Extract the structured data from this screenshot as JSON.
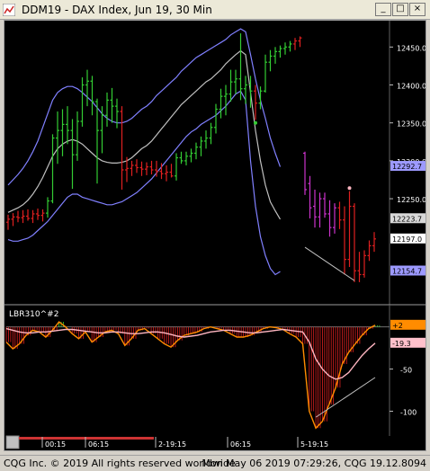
{
  "window": {
    "title": "DDM19 - DAX Index, Jun 19, 30 Min",
    "minimize_glyph": "_",
    "maximize_glyph": "□",
    "close_glyph": "×",
    "app_icon": "cqg-chart-icon"
  },
  "price_panel": {
    "axis_ticks": [
      "12450.0",
      "12400.0",
      "12350.0",
      "12300.0",
      "12250.0"
    ],
    "price_tags": [
      {
        "label": "12292.7",
        "color": "#9d9aff"
      },
      {
        "label": "12223.7",
        "color": "#d8d8d8"
      },
      {
        "label": "12197.0",
        "color": "#ffffff"
      },
      {
        "label": "12154.7",
        "color": "#9d9aff"
      }
    ]
  },
  "indicator_panel": {
    "label": "LBR310^#2",
    "axis_ticks": [
      "-50",
      "-100"
    ],
    "value_tags": [
      {
        "label": "+2",
        "color": "#ff8c00"
      },
      {
        "label": "-19.3",
        "color": "#ffc0cb"
      }
    ]
  },
  "time_axis": {
    "labels": [
      "00:15",
      "06:15",
      "2-19:15",
      "06:15",
      "5-19:15"
    ]
  },
  "status": {
    "left": "CQG Inc. © 2019 All rights reserved worldwide",
    "right": "Mon May 06 2019 07:29:26, CQG 19.12.8094"
  },
  "colors": {
    "background": "#000000",
    "bullish_bar": "#33cc33",
    "bearish_bar": "#e02020",
    "magenta_bar": "#cc33cc",
    "band": "#8080ff",
    "midline": "#c0c0c0",
    "oscillator": "#ff8c00",
    "signal": "#ffb6c1"
  },
  "chart_data": [
    {
      "type": "ohlc",
      "title": "",
      "ylabel": "",
      "ylim": [
        12115,
        12480
      ],
      "grid": false,
      "bars": [
        {
          "o": 12219,
          "h": 12229,
          "l": 12209,
          "c": 12223,
          "color": "red"
        },
        {
          "o": 12223,
          "h": 12231,
          "l": 12214,
          "c": 12226,
          "color": "red"
        },
        {
          "o": 12226,
          "h": 12234,
          "l": 12219,
          "c": 12225,
          "color": "red"
        },
        {
          "o": 12225,
          "h": 12235,
          "l": 12218,
          "c": 12227,
          "color": "red"
        },
        {
          "o": 12227,
          "h": 12236,
          "l": 12221,
          "c": 12224,
          "color": "red"
        },
        {
          "o": 12224,
          "h": 12235,
          "l": 12218,
          "c": 12230,
          "color": "red"
        },
        {
          "o": 12230,
          "h": 12237,
          "l": 12222,
          "c": 12228,
          "color": "red"
        },
        {
          "o": 12228,
          "h": 12236,
          "l": 12220,
          "c": 12231,
          "color": "red"
        },
        {
          "o": 12231,
          "h": 12252,
          "l": 12225,
          "c": 12247,
          "color": "green"
        },
        {
          "o": 12247,
          "h": 12335,
          "l": 12244,
          "c": 12330,
          "color": "green"
        },
        {
          "o": 12330,
          "h": 12365,
          "l": 12296,
          "c": 12340,
          "color": "green"
        },
        {
          "o": 12340,
          "h": 12368,
          "l": 12306,
          "c": 12348,
          "color": "green"
        },
        {
          "o": 12348,
          "h": 12372,
          "l": 12322,
          "c": 12340,
          "color": "green"
        },
        {
          "o": 12340,
          "h": 12355,
          "l": 12263,
          "c": 12308,
          "color": "green"
        },
        {
          "o": 12308,
          "h": 12365,
          "l": 12300,
          "c": 12352,
          "color": "green"
        },
        {
          "o": 12352,
          "h": 12410,
          "l": 12345,
          "c": 12400,
          "color": "green"
        },
        {
          "o": 12400,
          "h": 12420,
          "l": 12372,
          "c": 12405,
          "color": "green"
        },
        {
          "o": 12405,
          "h": 12412,
          "l": 12360,
          "c": 12378,
          "color": "green"
        },
        {
          "o": 12378,
          "h": 12382,
          "l": 12270,
          "c": 12340,
          "color": "green"
        },
        {
          "o": 12340,
          "h": 12372,
          "l": 12310,
          "c": 12360,
          "color": "green"
        },
        {
          "o": 12360,
          "h": 12390,
          "l": 12345,
          "c": 12380,
          "color": "green"
        },
        {
          "o": 12380,
          "h": 12396,
          "l": 12350,
          "c": 12372,
          "color": "green"
        },
        {
          "o": 12372,
          "h": 12382,
          "l": 12343,
          "c": 12365,
          "color": "green"
        },
        {
          "o": 12365,
          "h": 12372,
          "l": 12262,
          "c": 12288,
          "color": "red"
        },
        {
          "o": 12288,
          "h": 12305,
          "l": 12272,
          "c": 12290,
          "color": "red"
        },
        {
          "o": 12290,
          "h": 12300,
          "l": 12280,
          "c": 12294,
          "color": "red"
        },
        {
          "o": 12294,
          "h": 12302,
          "l": 12284,
          "c": 12291,
          "color": "red"
        },
        {
          "o": 12291,
          "h": 12299,
          "l": 12280,
          "c": 12289,
          "color": "red"
        },
        {
          "o": 12289,
          "h": 12298,
          "l": 12281,
          "c": 12292,
          "color": "red"
        },
        {
          "o": 12292,
          "h": 12300,
          "l": 12282,
          "c": 12288,
          "color": "red"
        },
        {
          "o": 12288,
          "h": 12300,
          "l": 12279,
          "c": 12286,
          "color": "red"
        },
        {
          "o": 12286,
          "h": 12297,
          "l": 12276,
          "c": 12283,
          "color": "red"
        },
        {
          "o": 12283,
          "h": 12294,
          "l": 12273,
          "c": 12285,
          "color": "red"
        },
        {
          "o": 12285,
          "h": 12296,
          "l": 12278,
          "c": 12280,
          "color": "red"
        },
        {
          "o": 12280,
          "h": 12310,
          "l": 12274,
          "c": 12304,
          "color": "green"
        },
        {
          "o": 12304,
          "h": 12312,
          "l": 12296,
          "c": 12300,
          "color": "green"
        },
        {
          "o": 12300,
          "h": 12312,
          "l": 12294,
          "c": 12306,
          "color": "green"
        },
        {
          "o": 12306,
          "h": 12316,
          "l": 12298,
          "c": 12310,
          "color": "green"
        },
        {
          "o": 12310,
          "h": 12324,
          "l": 12302,
          "c": 12318,
          "color": "green"
        },
        {
          "o": 12318,
          "h": 12332,
          "l": 12306,
          "c": 12326,
          "color": "green"
        },
        {
          "o": 12326,
          "h": 12340,
          "l": 12316,
          "c": 12330,
          "color": "green"
        },
        {
          "o": 12330,
          "h": 12350,
          "l": 12322,
          "c": 12344,
          "color": "green"
        },
        {
          "o": 12344,
          "h": 12375,
          "l": 12336,
          "c": 12368,
          "color": "green"
        },
        {
          "o": 12368,
          "h": 12395,
          "l": 12356,
          "c": 12385,
          "color": "green"
        },
        {
          "o": 12385,
          "h": 12400,
          "l": 12360,
          "c": 12388,
          "color": "green"
        },
        {
          "o": 12388,
          "h": 12420,
          "l": 12378,
          "c": 12404,
          "color": "green"
        },
        {
          "o": 12404,
          "h": 12420,
          "l": 12388,
          "c": 12408,
          "color": "green"
        },
        {
          "o": 12408,
          "h": 12468,
          "l": 12380,
          "c": 12395,
          "color": "green"
        },
        {
          "o": 12395,
          "h": 12412,
          "l": 12375,
          "c": 12400,
          "color": "green"
        },
        {
          "o": 12400,
          "h": 12412,
          "l": 12370,
          "c": 12392,
          "color": "green"
        },
        {
          "o": 12392,
          "h": 12400,
          "l": 12354,
          "c": 12376,
          "color": "red"
        },
        {
          "o": 12376,
          "h": 12398,
          "l": 12368,
          "c": 12392,
          "color": "green"
        },
        {
          "o": 12392,
          "h": 12440,
          "l": 12390,
          "c": 12430,
          "color": "green"
        },
        {
          "o": 12430,
          "h": 12446,
          "l": 12418,
          "c": 12438,
          "color": "green"
        },
        {
          "o": 12438,
          "h": 12450,
          "l": 12428,
          "c": 12444,
          "color": "green"
        },
        {
          "o": 12444,
          "h": 12452,
          "l": 12436,
          "c": 12448,
          "color": "green"
        },
        {
          "o": 12448,
          "h": 12456,
          "l": 12440,
          "c": 12450,
          "color": "green"
        },
        {
          "o": 12450,
          "h": 12458,
          "l": 12444,
          "c": 12454,
          "color": "green"
        },
        {
          "o": 12454,
          "h": 12462,
          "l": 12446,
          "c": 12458,
          "color": "red"
        },
        {
          "o": 12458,
          "h": 12464,
          "l": 12450,
          "c": 12462,
          "color": "red"
        },
        {
          "o": 12310,
          "h": 12312,
          "l": 12255,
          "c": 12262,
          "color": "magenta"
        },
        {
          "o": 12270,
          "h": 12280,
          "l": 12224,
          "c": 12238,
          "color": "magenta"
        },
        {
          "o": 12240,
          "h": 12262,
          "l": 12212,
          "c": 12226,
          "color": "magenta"
        },
        {
          "o": 12226,
          "h": 12258,
          "l": 12212,
          "c": 12250,
          "color": "magenta"
        },
        {
          "o": 12250,
          "h": 12258,
          "l": 12225,
          "c": 12230,
          "color": "magenta"
        },
        {
          "o": 12230,
          "h": 12248,
          "l": 12200,
          "c": 12212,
          "color": "magenta"
        },
        {
          "o": 12212,
          "h": 12244,
          "l": 12204,
          "c": 12238,
          "color": "magenta"
        },
        {
          "o": 12238,
          "h": 12246,
          "l": 12210,
          "c": 12222,
          "color": "red"
        },
        {
          "o": 12222,
          "h": 12240,
          "l": 12150,
          "c": 12170,
          "color": "red"
        },
        {
          "o": 12170,
          "h": 12260,
          "l": 12160,
          "c": 12240,
          "color": "red"
        },
        {
          "o": 12240,
          "h": 12244,
          "l": 12140,
          "c": 12155,
          "color": "red"
        },
        {
          "o": 12155,
          "h": 12180,
          "l": 12140,
          "c": 12150,
          "color": "red"
        },
        {
          "o": 12150,
          "h": 12182,
          "l": 12146,
          "c": 12175,
          "color": "red"
        },
        {
          "o": 12175,
          "h": 12195,
          "l": 12168,
          "c": 12188,
          "color": "red"
        },
        {
          "o": 12188,
          "h": 12206,
          "l": 12180,
          "c": 12197,
          "color": "red"
        }
      ],
      "upper_band": [
        12268,
        12275,
        12282,
        12290,
        12300,
        12312,
        12326,
        12344,
        12362,
        12380,
        12390,
        12395,
        12398,
        12398,
        12395,
        12390,
        12384,
        12378,
        12370,
        12362,
        12356,
        12352,
        12350,
        12350,
        12352,
        12356,
        12362,
        12368,
        12372,
        12378,
        12386,
        12392,
        12398,
        12404,
        12410,
        12418,
        12424,
        12430,
        12436,
        12440,
        12444,
        12448,
        12452,
        12456,
        12460,
        12466,
        12470,
        12474,
        12470,
        12440,
        12408,
        12380,
        12356,
        12330,
        12310,
        12292
      ],
      "middle_line": [
        12232,
        12235,
        12238,
        12242,
        12248,
        12256,
        12266,
        12278,
        12292,
        12306,
        12316,
        12322,
        12326,
        12328,
        12326,
        12322,
        12316,
        12310,
        12304,
        12300,
        12298,
        12297,
        12297,
        12298,
        12300,
        12304,
        12310,
        12316,
        12320,
        12326,
        12334,
        12342,
        12350,
        12358,
        12366,
        12374,
        12380,
        12386,
        12392,
        12398,
        12404,
        12408,
        12414,
        12420,
        12428,
        12434,
        12440,
        12445,
        12440,
        12390,
        12340,
        12300,
        12268,
        12246,
        12234,
        12223
      ],
      "lower_band": [
        12196,
        12194,
        12194,
        12196,
        12198,
        12202,
        12208,
        12214,
        12220,
        12228,
        12236,
        12244,
        12252,
        12256,
        12256,
        12252,
        12250,
        12248,
        12246,
        12244,
        12242,
        12242,
        12244,
        12246,
        12250,
        12254,
        12258,
        12264,
        12270,
        12276,
        12284,
        12292,
        12300,
        12308,
        12316,
        12324,
        12332,
        12338,
        12342,
        12348,
        12352,
        12356,
        12360,
        12366,
        12372,
        12380,
        12388,
        12392,
        12380,
        12300,
        12240,
        12200,
        12175,
        12158,
        12150,
        12154
      ],
      "annotations": [
        {
          "type": "dot",
          "bar_index": 50,
          "value": 12350,
          "color": "#33cc33"
        },
        {
          "type": "dot",
          "bar_index": 69,
          "value": 12264,
          "color": "#ffb6c1"
        },
        {
          "type": "trendline",
          "from": {
            "bar_index": 60,
            "value": 12186
          },
          "to": {
            "bar_index": 70,
            "value": 12142
          },
          "color": "#c0c0c0"
        }
      ]
    },
    {
      "type": "line",
      "title": "LBR310^#2",
      "ylim": [
        -125,
        5
      ],
      "series": [
        {
          "name": "",
          "values": [
            -18,
            -26,
            -20,
            -10,
            -4,
            -6,
            -12,
            -4,
            6,
            0,
            -8,
            -14,
            -6,
            -18,
            -12,
            -6,
            -4,
            -8,
            -22,
            -14,
            -4,
            -2,
            -8,
            -14,
            -20,
            -24,
            -16,
            -10,
            -8,
            -6,
            -2,
            0,
            -2,
            -4,
            -8,
            -12,
            -12,
            -10,
            -6,
            -2,
            0,
            -1,
            -3,
            -8,
            -12,
            -20,
            -100,
            -120,
            -112,
            -92,
            -72,
            -44,
            -30,
            -20,
            -10,
            -2,
            2
          ]
        },
        {
          "name": "",
          "values": [
            -2,
            -4,
            -6,
            -7,
            -7,
            -6,
            -6,
            -5,
            -4,
            -3,
            -3,
            -4,
            -5,
            -6,
            -7,
            -7,
            -6,
            -6,
            -7,
            -8,
            -8,
            -7,
            -6,
            -6,
            -7,
            -9,
            -11,
            -12,
            -11,
            -10,
            -8,
            -6,
            -5,
            -4,
            -4,
            -5,
            -6,
            -7,
            -7,
            -6,
            -5,
            -4,
            -3,
            -4,
            -5,
            -6,
            -18,
            -38,
            -50,
            -58,
            -62,
            -60,
            -54,
            -44,
            -34,
            -26,
            -19.3
          ]
        }
      ],
      "annotations": [
        {
          "type": "trendline",
          "from": {
            "index": 47,
            "value": -107
          },
          "to": {
            "index": 56,
            "value": -60
          },
          "color": "#c0c0c0"
        }
      ]
    }
  ]
}
